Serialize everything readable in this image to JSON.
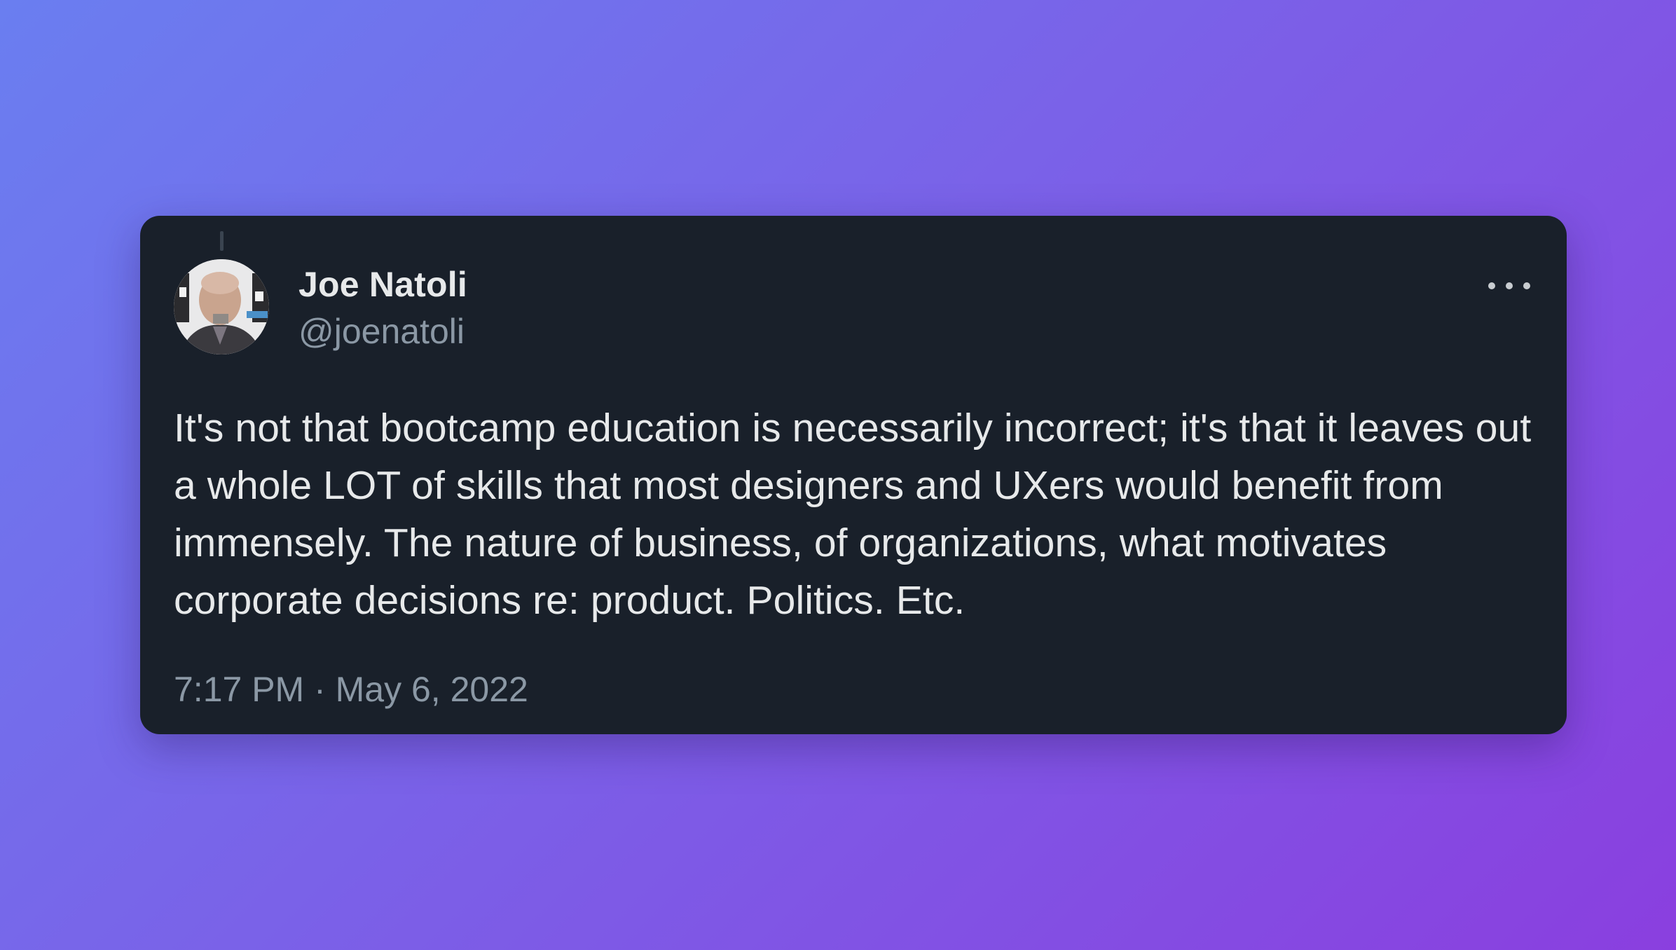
{
  "tweet": {
    "author_name": "Joe Natoli",
    "author_handle": "@joenatoli",
    "text": "It's not that bootcamp education is necessarily incorrect; it's that it leaves out a whole LOT of skills that most designers and UXers would benefit from immensely. The nature of business, of organizations, what motivates corporate decisions re: product. Politics. Etc.",
    "timestamp": "7:17 PM · May 6, 2022",
    "more_icon": "more-horizontal-icon"
  },
  "colors": {
    "card_background": "#19202a",
    "primary_text": "#e7e9ea",
    "secondary_text": "#8b98a5",
    "background_gradient_start": "#6a7ef0",
    "background_gradient_end": "#8a3fdf"
  }
}
